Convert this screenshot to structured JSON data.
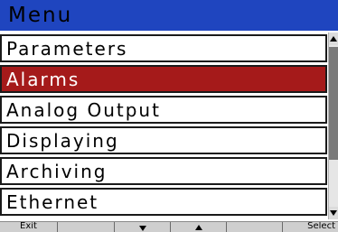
{
  "header": {
    "title": "Menu"
  },
  "menu": {
    "items": [
      {
        "label": "Parameters",
        "selected": false
      },
      {
        "label": "Alarms",
        "selected": true
      },
      {
        "label": "Analog Output",
        "selected": false
      },
      {
        "label": "Displaying",
        "selected": false
      },
      {
        "label": "Archiving",
        "selected": false
      },
      {
        "label": "Ethernet",
        "selected": false
      }
    ]
  },
  "softkeys": {
    "exit": "Exit",
    "key2": "",
    "down_icon": "down-arrow-icon",
    "up_icon": "up-arrow-icon",
    "key5": "",
    "select": "Select"
  },
  "colors": {
    "titlebar": "#1f45bf",
    "selected_row": "#a51a1a"
  }
}
